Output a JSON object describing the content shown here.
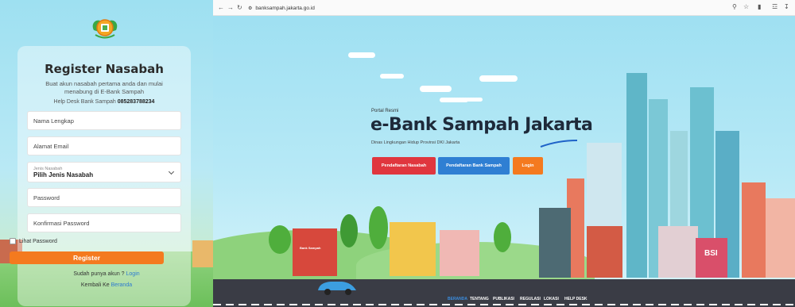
{
  "register": {
    "title": "Register Nasabah",
    "description": "Buat akun nasabah pertama anda dan mulai menabung di E-Bank Sampah",
    "help_prefix": "Help Desk Bank Sampah",
    "help_number": "085283788234",
    "fields": {
      "name_placeholder": "Nama Lengkap",
      "email_placeholder": "Alamat Email",
      "type_label": "Jenis Nasabah",
      "type_value": "Pilih Jenis Nasabah",
      "password_placeholder": "Password",
      "confirm_placeholder": "Konfirmasi Password"
    },
    "show_password": "Lihat Password",
    "register_button": "Register",
    "have_account": "Sudah punya akun ?",
    "login_link": "Login",
    "back_prefix": "Kembali Ke",
    "back_link": "Beranda"
  },
  "browser": {
    "url": "banksampah.jakarta.go.id"
  },
  "hero": {
    "portal": "Portal Resmi",
    "title": "e-Bank Sampah Jakarta",
    "subtitle": "Dinas Lingkungan Hidup Provinsi DKI Jakarta",
    "buttons": {
      "nasabah": "Pendaftaran Nasabah",
      "bank": "Pendaftaran Bank Sampah",
      "login": "Login"
    }
  },
  "scene": {
    "sign_bank": "Bank Sampah",
    "sign_bsi": "BSI"
  },
  "menu": [
    "BERANDA",
    "TENTANG",
    "PUBLIKASI",
    "REGULASI",
    "LOKASI",
    "HELP DESK"
  ],
  "colors": {
    "orange": "#f47a1f",
    "red": "#e0363e",
    "blue": "#2f7fd3",
    "link": "#2d7bd0"
  }
}
